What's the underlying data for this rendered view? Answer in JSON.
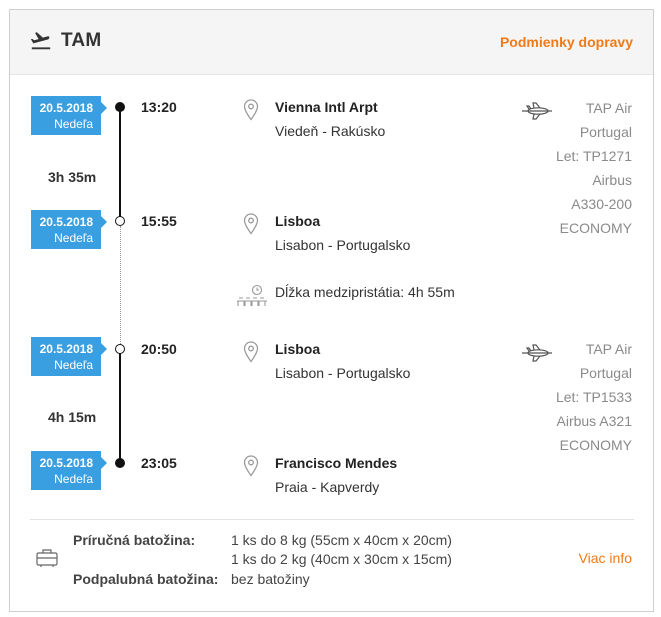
{
  "header": {
    "airline": "TAM",
    "conditions_link": "Podmienky dopravy"
  },
  "segments": [
    {
      "departure": {
        "date": "20.5.2018",
        "weekday": "Nedeľa",
        "time": "13:20",
        "place": "Vienna Intl Arpt",
        "city": "Viedeň - Rakúsko"
      },
      "duration": "3h 35m",
      "arrival": {
        "date": "20.5.2018",
        "weekday": "Nedeľa",
        "time": "15:55",
        "place": "Lisboa",
        "city": "Lisabon - Portugalsko"
      },
      "carrier": "TAP Air Portugal",
      "carrier_line1": "TAP Air",
      "carrier_line2": "Portugal",
      "flight": "Let: TP1271",
      "aircraft_line1": "Airbus",
      "aircraft_line2": "A330-200",
      "cabin": "ECONOMY"
    },
    {
      "departure": {
        "date": "20.5.2018",
        "weekday": "Nedeľa",
        "time": "20:50",
        "place": "Lisboa",
        "city": "Lisabon - Portugalsko"
      },
      "duration": "4h 15m",
      "arrival": {
        "date": "20.5.2018",
        "weekday": "Nedeľa",
        "time": "23:05",
        "place": "Francisco Mendes",
        "city": "Praia - Kapverdy"
      },
      "carrier_line1": "TAP Air",
      "carrier_line2": "Portugal",
      "flight": "Let: TP1533",
      "aircraft_line1": "Airbus A321",
      "cabin": "ECONOMY"
    }
  ],
  "layover": {
    "text": "Dĺžka medzipristátia: 4h 55m"
  },
  "baggage": {
    "hand_label": "Príručná batožina:",
    "hand_values": [
      "1 ks do 8 kg (55cm x 40cm x 20cm)",
      "1 ks do 2 kg (40cm x 30cm x 15cm)"
    ],
    "checked_label": "Podpalubná batožina:",
    "checked_value": "bez batožiny",
    "more_info": "Viac info"
  },
  "icons": {
    "header": "takeoff-icon",
    "place": "location-pin-icon",
    "flight": "airplane-icon",
    "layover": "waiting-room-clock-icon",
    "baggage": "luggage-icon"
  },
  "colors": {
    "accent": "#f07a17",
    "badge": "#3a9fe0",
    "header_bg": "#f5f5f5",
    "muted": "#8a8a8a"
  }
}
